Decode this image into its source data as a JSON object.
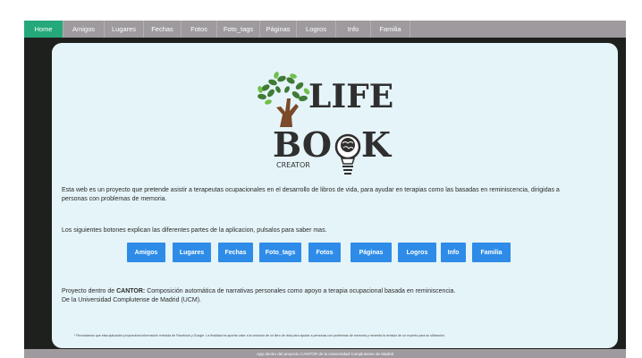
{
  "nav": {
    "items": [
      {
        "label": "Home",
        "active": true
      },
      {
        "label": "Amigos"
      },
      {
        "label": "Lugares"
      },
      {
        "label": "Fechas"
      },
      {
        "label": "Fotos"
      },
      {
        "label": "Foto_tags"
      },
      {
        "label": "Páginas"
      },
      {
        "label": "Logros"
      },
      {
        "label": "Info"
      },
      {
        "label": "Familia"
      }
    ]
  },
  "logo": {
    "word1": "LIFE",
    "word2": "BO",
    "word3": "K",
    "subtitle": "CREATOR"
  },
  "intro": {
    "line1": "Esta web es un proyecto que pretende asistir a terapeutas ocupacionales en el desarrollo de libros de vida, para ayudar en terapias como las basadas en reminiscencia, dirigidas a",
    "line2": "personas con problemas de memoria."
  },
  "buttons_hint": "Los siguientes botones explican las diferentes partes de la aplicacion, pulsalos para saber mas.",
  "buttons": [
    "Amigos",
    "Lugares",
    "Fechas",
    "Foto_tags",
    "Fotos",
    "Páginas",
    "Logros",
    "Info",
    "Familia"
  ],
  "project": {
    "prefix": "Proyecto dentro de ",
    "name": "CANTOR:",
    "description": " Composición automática de narrativas personales como apoyo a terapia ocupacional basada en reminiscencia.",
    "university": "De la Universidad Complutense de Madrid (UCM)."
  },
  "footnote": "* Recordamos que esta aplicación proporciona información extraída de Facebook y Google. La finalidad es aportar valor a la creación de un libro de vida para ayudar a personas con problemas de memoria y necesita la revisión de un experto para su utilización.",
  "footer": "App dentro del proyecto CANTOR de la Universidad Complutense de Madrid",
  "colors": {
    "nav_bg": "#9e9a9e",
    "nav_active": "#25a97b",
    "card_bg": "#e5f4f8",
    "button_blue": "#2e8ce8",
    "dark_bg": "#1e201e"
  }
}
